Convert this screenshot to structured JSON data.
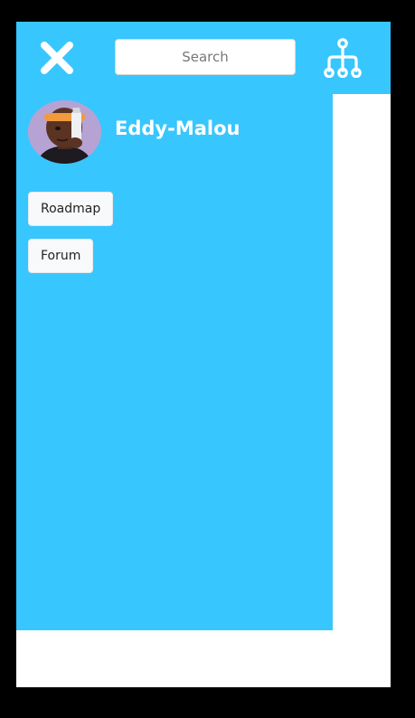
{
  "header": {
    "close_icon": "close-icon",
    "search": {
      "placeholder": "Search",
      "value": ""
    },
    "sitemap_icon": "sitemap-icon"
  },
  "drawer": {
    "user": {
      "name": "Eddy-Malou",
      "avatar": "user-avatar-photo"
    },
    "nav_items": [
      {
        "label": "Roadmap"
      },
      {
        "label": "Forum"
      }
    ]
  },
  "colors": {
    "primary": "#38c6fe",
    "page_background": "#ffffff",
    "frame": "#000000",
    "button_background": "#f8f9fa",
    "text_on_primary": "#ffffff",
    "button_text": "#222222"
  }
}
